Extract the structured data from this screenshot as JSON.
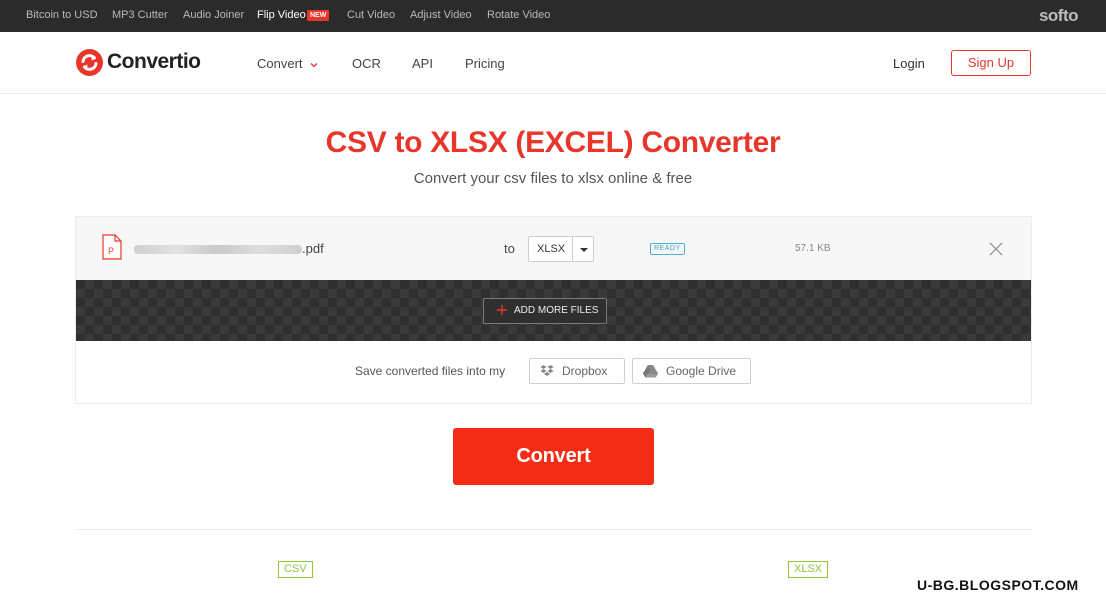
{
  "topbar": {
    "links": [
      "Bitcoin to USD",
      "MP3 Cutter",
      "Audio Joiner",
      "Flip Video",
      "Cut Video",
      "Adjust Video",
      "Rotate Video"
    ],
    "new_badge": "NEW",
    "brand": "softo"
  },
  "header": {
    "logo_text": "Convertio",
    "nav": [
      "Convert",
      "OCR",
      "API",
      "Pricing"
    ],
    "login": "Login",
    "signup": "Sign Up"
  },
  "main": {
    "title": "CSV to XLSX (EXCEL) Converter",
    "subtitle": "Convert your csv files to xlsx online & free"
  },
  "file": {
    "name_suffix": ".pdf",
    "to_label": "to",
    "format": "XLSX",
    "status": "READY",
    "size": "57.1 KB"
  },
  "actions": {
    "add_more": "ADD MORE FILES",
    "save_label": "Save converted files into my",
    "dropbox": "Dropbox",
    "google_drive": "Google Drive",
    "convert": "Convert"
  },
  "formats": {
    "from": "CSV",
    "to": "XLSX"
  },
  "watermark": "U-BG.BLOGSPOT.COM",
  "colors": {
    "accent": "#e8362b",
    "convert": "#f52c15",
    "ready": "#3aa3cf",
    "format_tag": "#8dc63f"
  }
}
